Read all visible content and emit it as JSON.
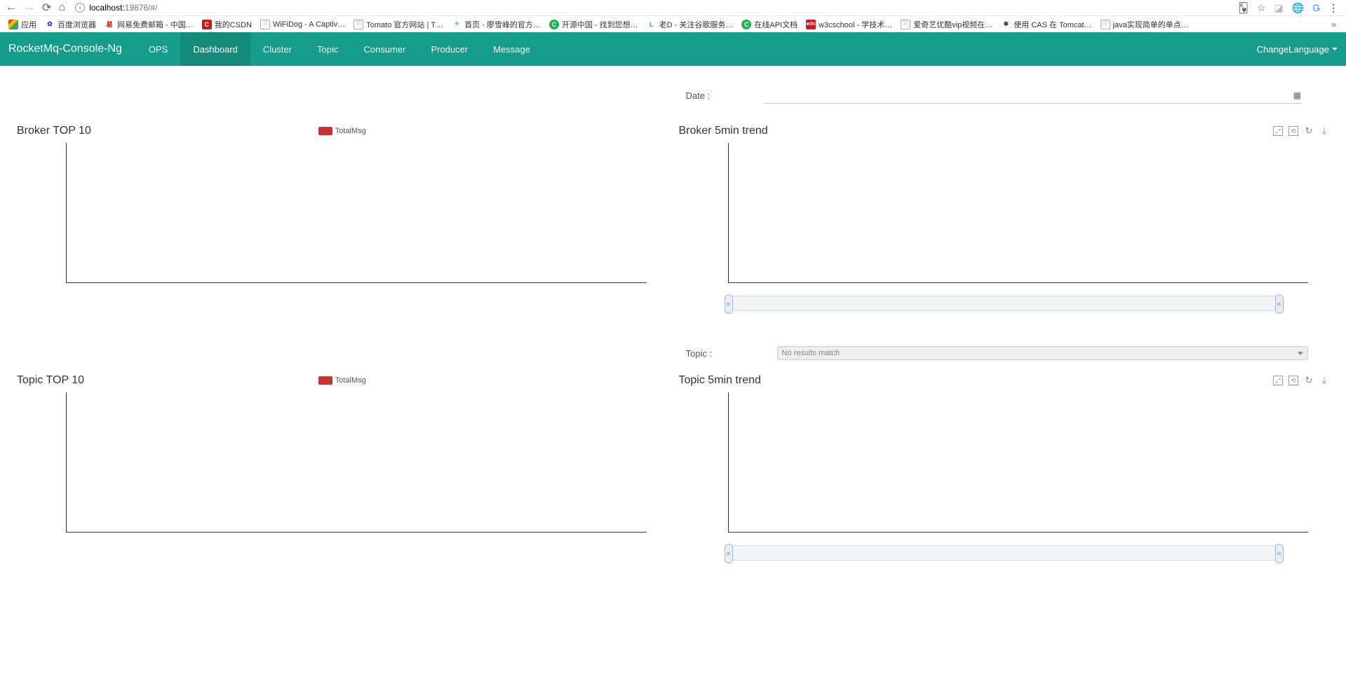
{
  "browser": {
    "url_host": "localhost:",
    "url_port_path": "19876/#/",
    "bookmarks": [
      {
        "label": "应用"
      },
      {
        "label": "百度浏览器"
      },
      {
        "label": "网易免费邮箱 - 中国…"
      },
      {
        "label": "我的CSDN"
      },
      {
        "label": "WiFiDog - A Captiv…"
      },
      {
        "label": "Tomato 官方网站 | T…"
      },
      {
        "label": "首页 - 廖雪峰的官方…"
      },
      {
        "label": "开源中国 - 找到您想…"
      },
      {
        "label": "老D - 关注谷歌服务…"
      },
      {
        "label": "在线API文档"
      },
      {
        "label": "w3cschool - 学技术…"
      },
      {
        "label": "爱奇艺优酷vip视频在…"
      },
      {
        "label": "使用 CAS 在 Tomcat…"
      },
      {
        "label": "java实现简单的单点…"
      }
    ]
  },
  "nav": {
    "brand": "RocketMq-Console-Ng",
    "items": [
      "OPS",
      "Dashboard",
      "Cluster",
      "Topic",
      "Consumer",
      "Producer",
      "Message"
    ],
    "active": "Dashboard",
    "lang": "ChangeLanguage"
  },
  "dashboard": {
    "date_label": "Date :",
    "broker_top_title": "Broker TOP 10",
    "broker_top_legend": "TotalMsg",
    "broker_trend_title": "Broker 5min trend",
    "topic_label": "Topic :",
    "topic_select_placeholder": "No results match",
    "topic_top_title": "Topic TOP 10",
    "topic_top_legend": "TotalMsg",
    "topic_trend_title": "Topic 5min trend"
  },
  "chart_data": [
    {
      "type": "bar",
      "title": "Broker TOP 10",
      "series": [
        {
          "name": "TotalMsg",
          "values": []
        }
      ],
      "categories": []
    },
    {
      "type": "line",
      "title": "Broker 5min trend",
      "series": [],
      "x": []
    },
    {
      "type": "bar",
      "title": "Topic TOP 10",
      "series": [
        {
          "name": "TotalMsg",
          "values": []
        }
      ],
      "categories": []
    },
    {
      "type": "line",
      "title": "Topic 5min trend",
      "series": [],
      "x": []
    }
  ]
}
